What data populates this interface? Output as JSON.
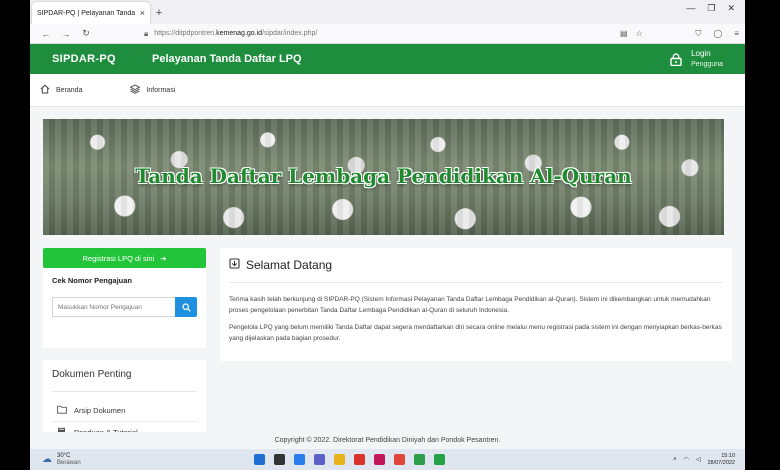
{
  "browser": {
    "tab_title": "SIPDAR-PQ | Pelayanan Tanda Daft",
    "tab_close": "×",
    "new_tab": "+",
    "url_prefix": "https://ditpdpontren.",
    "url_host": "kemenag.go.id",
    "url_path": "/sipdar/index.php/",
    "win_min": "—",
    "win_max": "❐",
    "win_close": "✕"
  },
  "header": {
    "brand": "SIPDAR-PQ",
    "title": "Pelayanan Tanda Daftar LPQ",
    "login_label": "Login",
    "login_sub": "Pengguna"
  },
  "menu": {
    "items": [
      {
        "label": "Beranda",
        "icon": "home-icon"
      },
      {
        "label": "Informasi",
        "icon": "layers-icon"
      }
    ]
  },
  "banner": {
    "title": "Tanda Daftar Lembaga Pendidikan Al-Quran"
  },
  "sidebar": {
    "register_label": "Registrasi LPQ di sini",
    "check_label": "Cek Nomor Pengajuan",
    "check_placeholder": "Masukkan Nomor Pengajuan",
    "docs_title": "Dokumen Penting",
    "docs": [
      {
        "label": "Arsip Dokumen",
        "icon": "folder-icon"
      },
      {
        "label": "Panduan & Tutorial",
        "icon": "book-icon"
      }
    ]
  },
  "welcome": {
    "title": "Selamat Datang",
    "p1": "Terima kasih telah berkunjung di SIPDAR-PQ (Sistem Informasi Pelayanan Tanda Daftar Lembaga Pendidikan al-Quran). Sistem ini dikembangkan untuk memudahkan proses pengelolaan penerbitan Tanda Daftar Lembaga Pendidikan al-Quran di seluruh Indonesia.",
    "p2": "Pengelola LPQ yang belum memiliki Tanda Daftar dapat segera mendaftarkan diri secara online melalui menu registrasi pada sistem ini dengan menyiapkan berkas-berkas yang dijelaskan pada bagian prosedur."
  },
  "footer": {
    "text": "Copyright © 2022. Direktorat Pendidikan Diniyah dan Pondok Pesantren."
  },
  "taskbar": {
    "temp": "30°C",
    "weather": "Berawan",
    "time": "15:10",
    "date": "28/07/2022",
    "app_colors": [
      "#1f6fd1",
      "#333333",
      "#2b7de9",
      "#5b5fc7",
      "#e8b21a",
      "#d8322b",
      "#c2185b",
      "#e0463b",
      "#2e9e4a",
      "#25a244"
    ]
  }
}
